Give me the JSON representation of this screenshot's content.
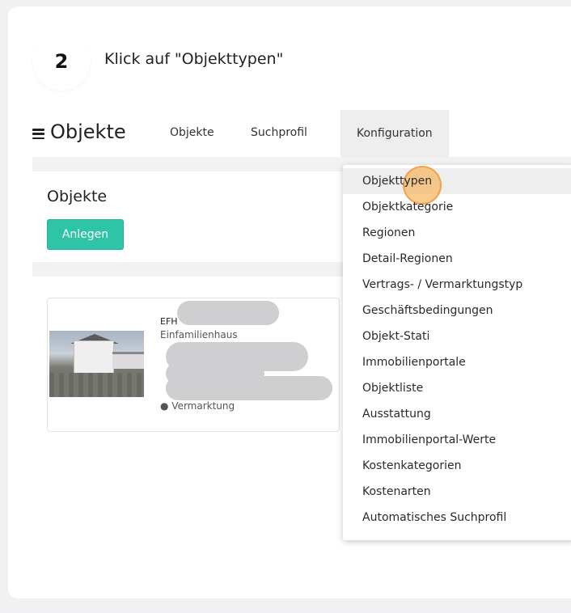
{
  "step": {
    "number": "2",
    "instruction": "Klick auf \"Objekttypen\""
  },
  "app": {
    "brand": "Objekte",
    "nav": [
      "Objekte",
      "Suchprofil",
      "Konfiguration"
    ]
  },
  "panel": {
    "title": "Objekte",
    "button": "Anlegen"
  },
  "listing": {
    "title": "EFH",
    "type": "Einfamilienhaus",
    "status": "● Vermarktung"
  },
  "dropdown": {
    "items": [
      "Objekttypen",
      "Objektkategorie",
      "Regionen",
      "Detail-Regionen",
      "Vertrags- / Vermarktungstyp",
      "Geschäftsbedingungen",
      "Objekt-Stati",
      "Immobilienportale",
      "Objektliste",
      "Ausstattung",
      "Immobilienportal-Werte",
      "Kostenkategorien",
      "Kostenarten",
      "Automatisches Suchprofil"
    ]
  },
  "colors": {
    "accent": "#2ec4a6",
    "highlight": "#f7ad4a"
  }
}
